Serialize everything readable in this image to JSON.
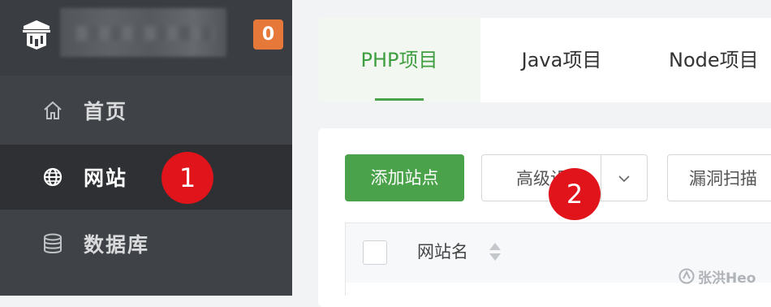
{
  "sidebar": {
    "badge_count": "0",
    "items": [
      {
        "label": "首页",
        "icon": "home-icon"
      },
      {
        "label": "网站",
        "icon": "globe-icon",
        "active": true
      },
      {
        "label": "数据库",
        "icon": "database-icon"
      }
    ]
  },
  "annotations": {
    "step1": "1",
    "step2": "2"
  },
  "tabs": [
    {
      "label": "PHP项目",
      "active": true
    },
    {
      "label": "Java项目"
    },
    {
      "label": "Node项目"
    }
  ],
  "toolbar": {
    "add_site": "添加站点",
    "advanced": "高级设",
    "vuln_scan": "漏洞扫描"
  },
  "table": {
    "columns": [
      "网站名"
    ]
  },
  "watermark": "张洪Heo",
  "colors": {
    "sidebar_bg": "#3f4246",
    "accent_green": "#4aa34a",
    "badge_orange": "#e6793a",
    "step_red": "#e0141a"
  }
}
